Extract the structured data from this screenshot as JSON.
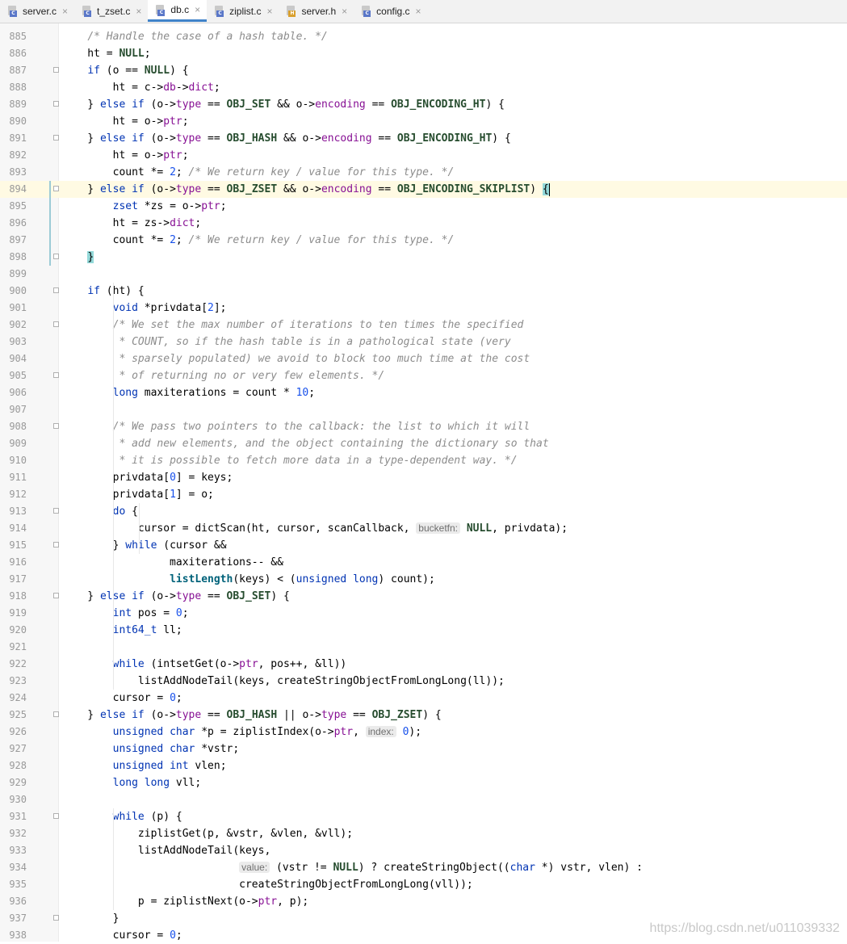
{
  "tabs": [
    {
      "name": "server.c",
      "type": "C"
    },
    {
      "name": "t_zset.c",
      "type": "C"
    },
    {
      "name": "db.c",
      "type": "C",
      "active": true
    },
    {
      "name": "ziplist.c",
      "type": "C"
    },
    {
      "name": "server.h",
      "type": "H"
    },
    {
      "name": "config.c",
      "type": "C"
    }
  ],
  "editor": {
    "current_line": 894,
    "lines": [
      {
        "n": "885",
        "code": "    /* Handle the case of a hash table. */"
      },
      {
        "n": "886",
        "code": "    ht = NULL;"
      },
      {
        "n": "887",
        "code": "    if (o == NULL) {"
      },
      {
        "n": "888",
        "code": "        ht = c->db->dict;"
      },
      {
        "n": "889",
        "code": "    } else if (o->type == OBJ_SET && o->encoding == OBJ_ENCODING_HT) {"
      },
      {
        "n": "890",
        "code": "        ht = o->ptr;"
      },
      {
        "n": "891",
        "code": "    } else if (o->type == OBJ_HASH && o->encoding == OBJ_ENCODING_HT) {"
      },
      {
        "n": "892",
        "code": "        ht = o->ptr;"
      },
      {
        "n": "893",
        "code": "        count *= 2; /* We return key / value for this type. */"
      },
      {
        "n": "894",
        "code": "    } else if (o->type == OBJ_ZSET && o->encoding == OBJ_ENCODING_SKIPLIST) {"
      },
      {
        "n": "895",
        "code": "        zset *zs = o->ptr;"
      },
      {
        "n": "896",
        "code": "        ht = zs->dict;"
      },
      {
        "n": "897",
        "code": "        count *= 2; /* We return key / value for this type. */"
      },
      {
        "n": "898",
        "code": "    }"
      },
      {
        "n": "899",
        "code": ""
      },
      {
        "n": "900",
        "code": "    if (ht) {"
      },
      {
        "n": "901",
        "code": "        void *privdata[2];"
      },
      {
        "n": "902",
        "code": "        /* We set the max number of iterations to ten times the specified"
      },
      {
        "n": "903",
        "code": "         * COUNT, so if the hash table is in a pathological state (very"
      },
      {
        "n": "904",
        "code": "         * sparsely populated) we avoid to block too much time at the cost"
      },
      {
        "n": "905",
        "code": "         * of returning no or very few elements. */"
      },
      {
        "n": "906",
        "code": "        long maxiterations = count * 10;"
      },
      {
        "n": "907",
        "code": ""
      },
      {
        "n": "908",
        "code": "        /* We pass two pointers to the callback: the list to which it will"
      },
      {
        "n": "909",
        "code": "         * add new elements, and the object containing the dictionary so that"
      },
      {
        "n": "910",
        "code": "         * it is possible to fetch more data in a type-dependent way. */"
      },
      {
        "n": "911",
        "code": "        privdata[0] = keys;"
      },
      {
        "n": "912",
        "code": "        privdata[1] = o;"
      },
      {
        "n": "913",
        "code": "        do {"
      },
      {
        "n": "914",
        "code": "            cursor = dictScan(ht, cursor, scanCallback, bucketfn: NULL, privdata);"
      },
      {
        "n": "915",
        "code": "        } while (cursor &&"
      },
      {
        "n": "916",
        "code": "                 maxiterations-- &&"
      },
      {
        "n": "917",
        "code": "                 listLength(keys) < (unsigned long) count);"
      },
      {
        "n": "918",
        "code": "    } else if (o->type == OBJ_SET) {"
      },
      {
        "n": "919",
        "code": "        int pos = 0;"
      },
      {
        "n": "920",
        "code": "        int64_t ll;"
      },
      {
        "n": "921",
        "code": ""
      },
      {
        "n": "922",
        "code": "        while (intsetGet(o->ptr, pos++, &ll))"
      },
      {
        "n": "923",
        "code": "            listAddNodeTail(keys, createStringObjectFromLongLong(ll));"
      },
      {
        "n": "924",
        "code": "        cursor = 0;"
      },
      {
        "n": "925",
        "code": "    } else if (o->type == OBJ_HASH || o->type == OBJ_ZSET) {"
      },
      {
        "n": "926",
        "code": "        unsigned char *p = ziplistIndex(o->ptr, index: 0);"
      },
      {
        "n": "927",
        "code": "        unsigned char *vstr;"
      },
      {
        "n": "928",
        "code": "        unsigned int vlen;"
      },
      {
        "n": "929",
        "code": "        long long vll;"
      },
      {
        "n": "930",
        "code": ""
      },
      {
        "n": "931",
        "code": "        while (p) {"
      },
      {
        "n": "932",
        "code": "            ziplistGet(p, &vstr, &vlen, &vll);"
      },
      {
        "n": "933",
        "code": "            listAddNodeTail(keys,"
      },
      {
        "n": "934",
        "code": "                            value: (vstr != NULL) ? createStringObject((char *) vstr, vlen) :"
      },
      {
        "n": "935",
        "code": "                            createStringObjectFromLongLong(vll));"
      },
      {
        "n": "936",
        "code": "            p = ziplistNext(o->ptr, p);"
      },
      {
        "n": "937",
        "code": "        }"
      },
      {
        "n": "938",
        "code": "        cursor = 0;"
      }
    ],
    "fold_lines": [
      "887",
      "889",
      "891",
      "894",
      "898",
      "900",
      "902",
      "905",
      "908",
      "913",
      "915",
      "918",
      "925",
      "931",
      "937"
    ]
  },
  "watermark": "https://blog.csdn.net/u011039332"
}
